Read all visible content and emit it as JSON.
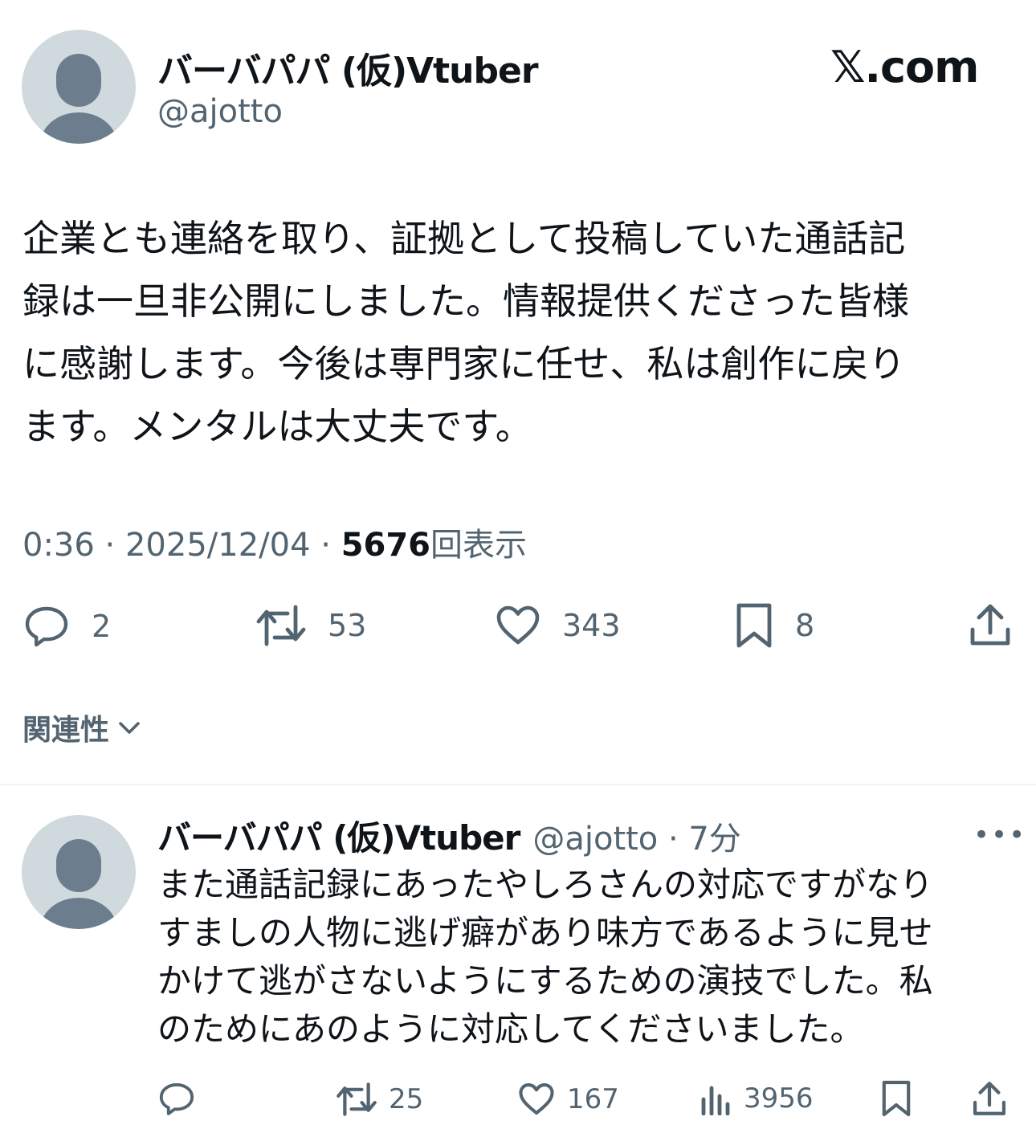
{
  "header": {
    "display_name": "バーバパパ (仮)Vtuber",
    "handle": "@ajotto",
    "site_label": "𝕏.com"
  },
  "post": {
    "lines": [
      "企業とも連絡を取り、証拠として投稿していた通話記",
      "録は一旦非公開にしました。情報提供くださった皆様",
      "に感謝します。今後は専門家に任せ、私は創作に戻り",
      "ます。メンタルは大丈夫です。"
    ],
    "time": "0:36",
    "date": "2025/12/04",
    "separator": "·",
    "views_count": "5676",
    "views_label": "回表示",
    "actions": {
      "reply_count": "2",
      "repost_count": "53",
      "like_count": "343",
      "bookmark_count": "8"
    }
  },
  "related": {
    "label": "関連性"
  },
  "reply": {
    "display_name": "バーバパパ (仮)Vtuber",
    "handle_time": "@ajotto · 7分",
    "more_label": "•••",
    "lines": [
      "また通話記録にあったやしろさんの対応ですがなり",
      "すましの人物に逃げ癖があり味方であるように見せ",
      "かけて逃がさないようにするための演技でした。私",
      "のためにあのように対応してくださいました。"
    ],
    "actions": {
      "reply_count": "",
      "repost_count": "25",
      "like_count": "167",
      "views_count": "3956"
    }
  }
}
